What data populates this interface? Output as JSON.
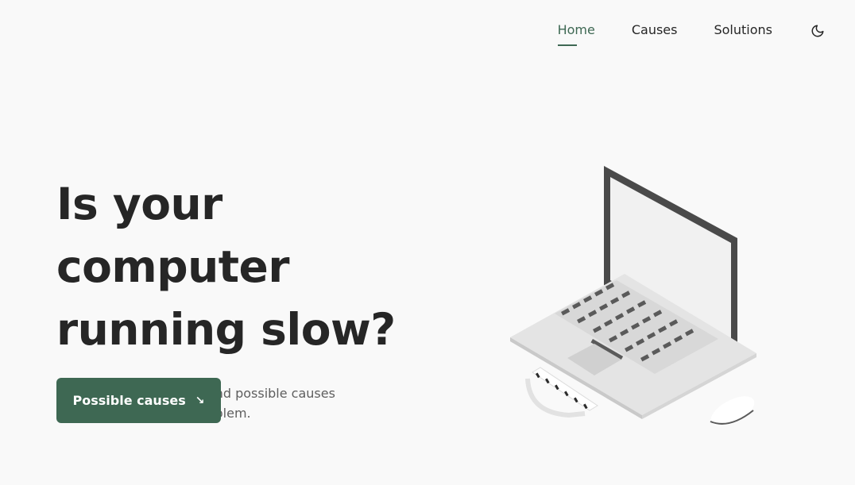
{
  "nav": {
    "items": [
      {
        "label": "Home",
        "active": true
      },
      {
        "label": "Causes",
        "active": false
      },
      {
        "label": "Solutions",
        "active": false
      }
    ],
    "theme_toggle_icon": "moon-icon"
  },
  "hero": {
    "title_line1": "Is your computer",
    "title_line2": "running slow?",
    "description_line1": "In this website you can find possible causes",
    "description_line2": "and solutions for this problem.",
    "cta_label": "Possible causes",
    "cta_icon": "arrow-down-right-icon"
  },
  "illustration": {
    "icon": "laptop-illustration"
  },
  "colors": {
    "accent": "#3e6853",
    "background": "#f9f9f9",
    "text": "#262626"
  }
}
